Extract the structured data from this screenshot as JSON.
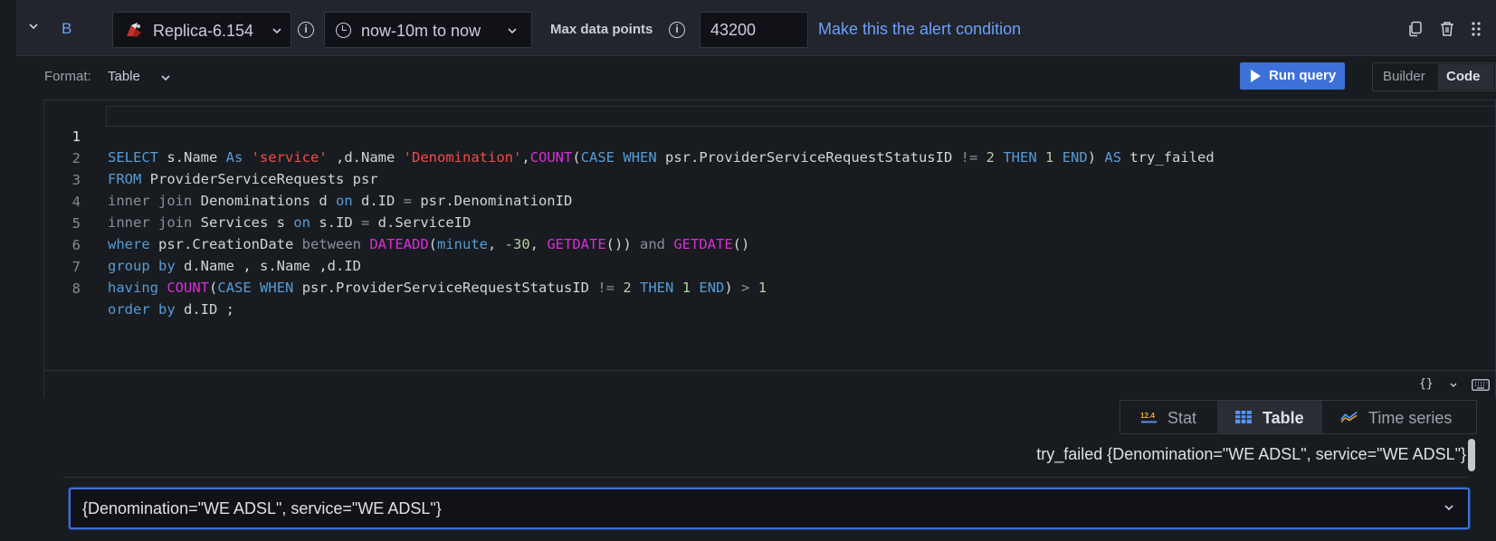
{
  "query_row": {
    "ref_id": "B",
    "datasource": "Replica-6.154",
    "time_range": "now-10m to now",
    "max_data_points_label": "Max data points",
    "max_data_points_value": "43200",
    "alert_link": "Make this the alert condition"
  },
  "options": {
    "format_label": "Format:",
    "format_value": "Table",
    "run_query_label": "Run query",
    "mode_builder": "Builder",
    "mode_code": "Code"
  },
  "editor": {
    "line_numbers": [
      "1",
      "2",
      "3",
      "4",
      "5",
      "6",
      "7",
      "8"
    ],
    "tokens": {
      "l1": [
        "SELECT",
        " s.Name ",
        "As",
        " ",
        "'service'",
        " ,d.Name ",
        "'Denomination'",
        ",",
        "COUNT",
        "(",
        "CASE",
        " ",
        "WHEN",
        " psr.ProviderServiceRequestStatusID ",
        "!=",
        " ",
        "2",
        " ",
        "THEN",
        " ",
        "1",
        " ",
        "END",
        ") ",
        "AS",
        " try_failed"
      ],
      "l2": [
        "FROM",
        " ProviderServiceRequests psr"
      ],
      "l3": [
        "inner",
        " ",
        "join",
        " Denominations d ",
        "on",
        " d.ID ",
        "=",
        " psr.DenominationID"
      ],
      "l4": [
        "inner",
        " ",
        "join",
        " Services s ",
        "on",
        " s.ID ",
        "=",
        " d.ServiceID"
      ],
      "l5": [
        "where",
        " psr.CreationDate ",
        "between",
        " ",
        "DATEADD",
        "(",
        "minute",
        ", ",
        "-30",
        ", ",
        "GETDATE",
        "()) ",
        "and",
        " ",
        "GETDATE",
        "()"
      ],
      "l6": [
        "group",
        " ",
        "by",
        " d.Name , s.Name ,d.ID"
      ],
      "l7": [
        "having",
        " ",
        "COUNT",
        "(",
        "CASE",
        " ",
        "WHEN",
        " psr.ProviderServiceRequestStatusID ",
        "!=",
        " ",
        "2",
        " ",
        "THEN",
        " ",
        "1",
        " ",
        "END",
        ") ",
        ">",
        " ",
        "1"
      ],
      "l8": [
        "order",
        " ",
        "by",
        " d.ID ;"
      ]
    },
    "footer_format": "{}",
    "footer_chevron": "⌄"
  },
  "viz_picker": {
    "stat_label": "Stat",
    "stat_icon_text": "12.4",
    "table_label": "Table",
    "timeseries_label": "Time series"
  },
  "preview": {
    "series_label": "try_failed {Denomination=\"WE ADSL\", service=\"WE ADSL\"}",
    "selected_series": "{Denomination=\"WE ADSL\", service=\"WE ADSL\"}"
  },
  "colors": {
    "accent": "#3d71d9",
    "link": "#6e9fff",
    "keyword": "#569cd6",
    "string": "#f14c4c",
    "function": "#d82ed8"
  }
}
